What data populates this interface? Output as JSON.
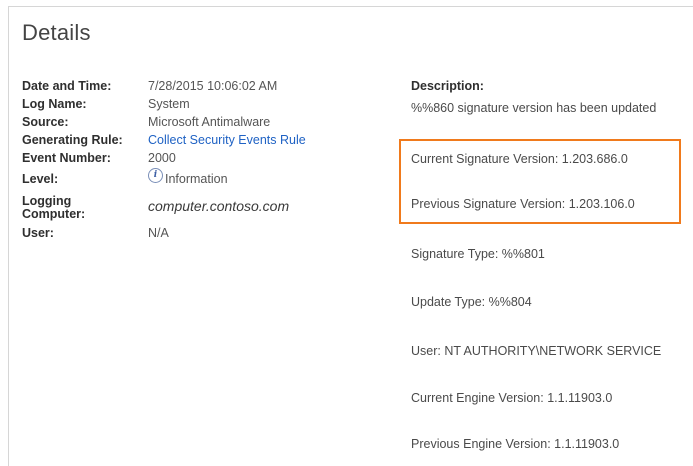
{
  "details": {
    "title": "Details",
    "properties": [
      {
        "label": "Date and Time:",
        "value": "7/28/2015 10:06:02 AM"
      },
      {
        "label": "Log Name:",
        "value": "System"
      },
      {
        "label": "Source:",
        "value": "Microsoft Antimalware"
      },
      {
        "label": "Generating Rule:",
        "value": "Collect Security Events Rule"
      },
      {
        "label": "Event Number:",
        "value": "2000"
      },
      {
        "label": "Level:",
        "value": "Information",
        "icon": "info-icon"
      },
      {
        "label_line1": "Logging",
        "label_line2": "Computer:",
        "value": "computer.contoso.com"
      },
      {
        "label": "User:",
        "value": "N/A"
      }
    ],
    "description": {
      "label": "Description:",
      "lines": [
        "%%860 signature version has been updated",
        "Current Signature Version: 1.203.686.0",
        "Previous Signature Version: 1.203.106.0",
        "Signature Type: %%801",
        "Update Type: %%804",
        "User: NT AUTHORITY\\NETWORK SERVICE",
        "Current Engine Version: 1.1.11903.0",
        "Previous Engine Version: 1.1.11903.0"
      ]
    },
    "highlight_color": "#f07a1c",
    "link_color": "#1f62c4"
  }
}
